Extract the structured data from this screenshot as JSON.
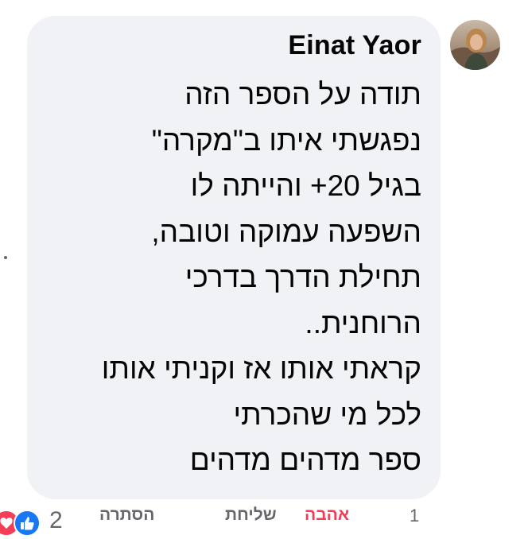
{
  "comment": {
    "author": "Einat Yaor",
    "lines": [
      "תודה על הספר הזה",
      "נפגשתי איתו ב\"מקרה\"",
      "בגיל 20+ והייתה לו",
      "השפעה עמוקה וטובה,",
      "תחילת הדרך בדרכי",
      "הרוחנית..",
      "קראתי אותו אז וקניתי אותו",
      "לכל מי שהכרתי",
      "ספר מדהים מדהים"
    ]
  },
  "actions": {
    "time": "1",
    "love": "אהבה",
    "reply": "שליחת",
    "hide": "הסתרה"
  },
  "reactions": {
    "count": "2",
    "icons": [
      "love-icon",
      "like-icon"
    ]
  },
  "colors": {
    "bubble": "#f0f2f5",
    "love": "#f33e58",
    "like": "#1877f2",
    "muted": "#65676b"
  }
}
